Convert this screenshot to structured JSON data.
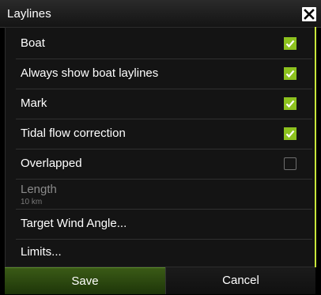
{
  "dialog": {
    "title": "Laylines",
    "close_icon": "close-icon"
  },
  "rows": [
    {
      "label": "Boat",
      "checked": true
    },
    {
      "label": "Always show boat laylines",
      "checked": true
    },
    {
      "label": "Mark",
      "checked": true
    },
    {
      "label": "Tidal flow correction",
      "checked": true
    },
    {
      "label": "Overlapped",
      "checked": false
    },
    {
      "label": "Length",
      "value": "10 km",
      "enabled": false
    },
    {
      "label": "Target Wind Angle..."
    },
    {
      "label": "Limits..."
    }
  ],
  "footer": {
    "save_label": "Save",
    "cancel_label": "Cancel"
  },
  "colors": {
    "accent": "#8dc21f",
    "scrollbar": "#c8e63a",
    "background": "#000000"
  }
}
